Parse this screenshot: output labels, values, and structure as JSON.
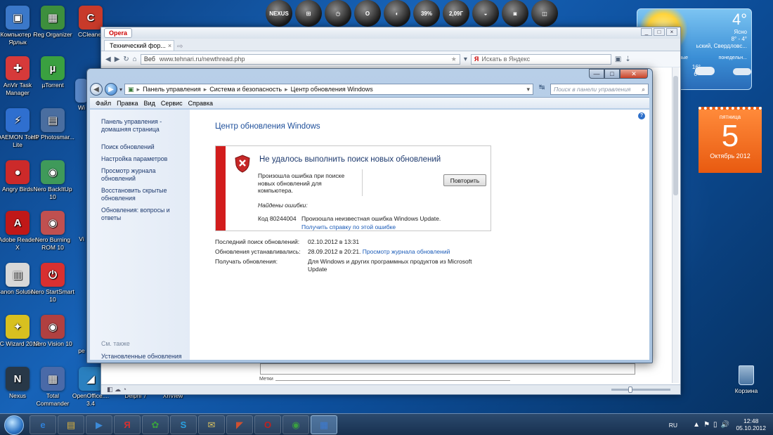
{
  "desktop_icons": [
    {
      "label": "Компьютер - Ярлык",
      "color": "#3b78c9",
      "glyph": "▣"
    },
    {
      "label": "Reg Organizer",
      "color": "#3d8f3d",
      "glyph": "▦"
    },
    {
      "label": "CCleaner",
      "color": "#c83a2a",
      "glyph": "C"
    },
    {
      "label": "AnVir Task Manager",
      "color": "#d63a3a",
      "glyph": "✚"
    },
    {
      "label": "µTorrent",
      "color": "#3aa040",
      "glyph": "µ"
    },
    {
      "label": "DAEMON Tools Lite",
      "color": "#2f6fcf",
      "glyph": "⚡"
    },
    {
      "label": "HP Photosmar...",
      "color": "#4a6ea0",
      "glyph": "▤"
    },
    {
      "label": "Angry Birds",
      "color": "#cc2a2a",
      "glyph": "●"
    },
    {
      "label": "Nero BackItUp 10",
      "color": "#3f9a5a",
      "glyph": "◉"
    },
    {
      "label": "Adobe Reader X",
      "color": "#c01818",
      "glyph": "A"
    },
    {
      "label": "Nero Burning ROM 10",
      "color": "#c05050",
      "glyph": "◉"
    },
    {
      "label": "Canon Solutio...",
      "color": "#d8d8d8",
      "glyph": "▥"
    },
    {
      "label": "Nero StartSmart 10",
      "color": "#d83030",
      "glyph": "⏻"
    },
    {
      "label": "PC Wizard 2012",
      "color": "#d8c020",
      "glyph": "✦"
    },
    {
      "label": "Nero Vision 10",
      "color": "#b04040",
      "glyph": "◉"
    },
    {
      "label": "Nexus",
      "color": "#283848",
      "glyph": "N"
    },
    {
      "label": "Total Commander",
      "color": "#4a6aa8",
      "glyph": "▦"
    },
    {
      "label": "OpenOffice.... 3.4",
      "color": "#2a80c0",
      "glyph": "◢"
    }
  ],
  "partial_icon_labels": {
    "wi": "Wi",
    "vi": "Vi",
    "pe": "pe",
    "delphi": "Delphi 7",
    "xnview": "XnView"
  },
  "dock": {
    "items": [
      "NEXUS",
      "⊞",
      "◷",
      "O",
      "◐",
      "39%",
      "2,09Г",
      "◒",
      "◙",
      "◫"
    ]
  },
  "weather": {
    "temp": "4°",
    "condition": "Ясно",
    "range": "8° - 4°",
    "city": "ьский, Свердловс...",
    "forecast_left": "прогнозные",
    "forecast_right": "понедельн...",
    "f1": "1°",
    "f2": "16°",
    "f3": "6°"
  },
  "calendar": {
    "weekday": "пятница",
    "day": "5",
    "month_year": "Октябрь 2012"
  },
  "opera": {
    "menu_button": "Opera",
    "tab_title": "Технический фор...",
    "tab_close": "×",
    "address_prefix": "Веб",
    "url": "www.tehnari.ru/newthread.php",
    "search_placeholder": "Искать в Яндекс",
    "tags_label": "Метки",
    "window_buttons": [
      "_",
      "□",
      "×"
    ]
  },
  "control_panel": {
    "window_buttons": [
      "—",
      "□",
      "✕"
    ],
    "breadcrumb": [
      "Панель управления",
      "Система и безопасность",
      "Центр обновления Windows"
    ],
    "search_placeholder": "Поиск в панели управления",
    "menu": [
      "Файл",
      "Правка",
      "Вид",
      "Сервис",
      "Справка"
    ],
    "sidebar": {
      "home": "Панель управления - домашняя страница",
      "links": [
        "Поиск обновлений",
        "Настройка параметров",
        "Просмотр журнала обновлений",
        "Восстановить скрытые обновления",
        "Обновления: вопросы и ответы"
      ],
      "see_also": "См. также",
      "installed": "Установленные обновления"
    },
    "title": "Центр обновления Windows",
    "error": {
      "heading": "Не удалось выполнить поиск новых обновлений",
      "description": "Произошла ошибка при поиске новых обновлений для компьютера.",
      "retry_button": "Повторить",
      "found_label": "Найдены ошибки:",
      "code": "Код 80244004",
      "message": "Произошла неизвестная ошибка Windows Update.",
      "help_link": "Получить справку по этой ошибке"
    },
    "info": {
      "last_search_label": "Последний поиск обновлений:",
      "last_search_value": "02.10.2012 в 13:31",
      "installed_label": "Обновления устанавливались:",
      "installed_value": "28.09.2012 в 20:21.",
      "installed_link": "Просмотр журнала обновлений",
      "receive_label": "Получать обновления:",
      "receive_value": "Для Windows и других программных продуктов из Microsoft Update"
    }
  },
  "recycle_bin": {
    "label": "Корзина"
  },
  "taskbar": {
    "items": [
      "e",
      "▤",
      "▶",
      "Я",
      "✿",
      "S",
      "✉",
      "◤",
      "O",
      "◉",
      "▦"
    ],
    "language": "RU",
    "tray_icons": [
      "▲",
      "⚑",
      "▯",
      "🔊"
    ],
    "time": "12:48",
    "date": "05.10.2012"
  }
}
